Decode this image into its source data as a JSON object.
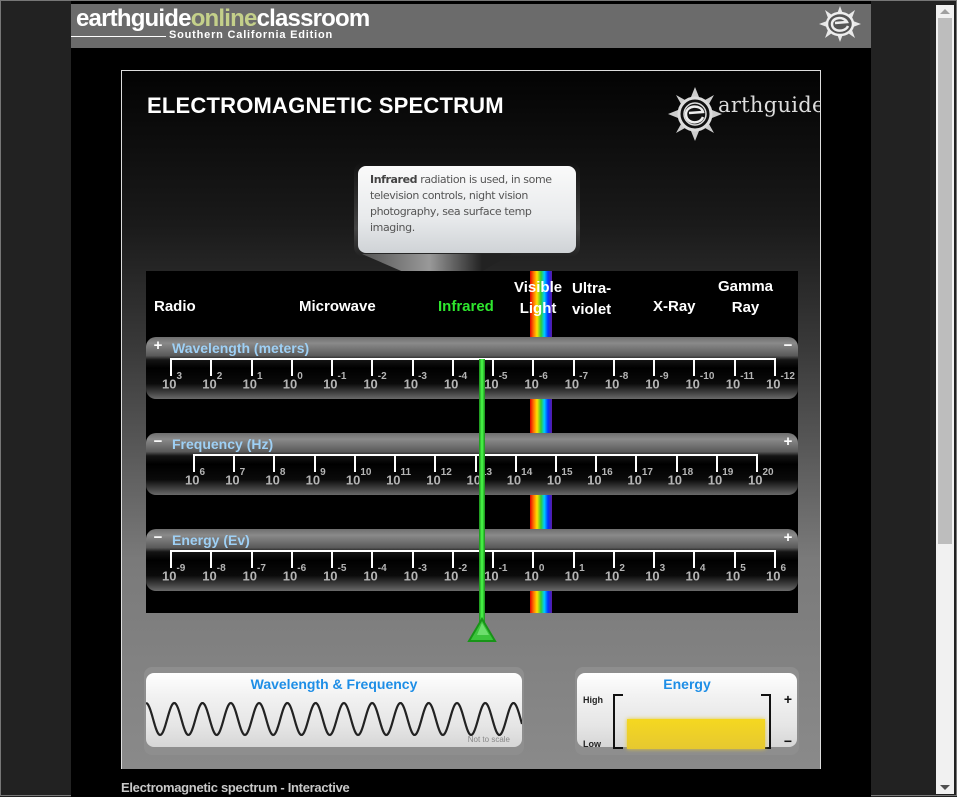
{
  "header": {
    "brand_part1": "earthguide",
    "brand_part2": "online",
    "brand_part3": "classroom",
    "subtitle": "Southern California Edition",
    "logo_icon": "earthguide-compass-icon"
  },
  "stage": {
    "title": "ELECTROMAGNETIC SPECTRUM",
    "logo_text": "arthguide",
    "logo_icon": "earthguide-compass-icon"
  },
  "tooltip": {
    "bold": "Infrared",
    "text": " radiation is used, in some television controls, night vision photography, sea surface temp imaging."
  },
  "bands": [
    {
      "label": "Radio",
      "active": false
    },
    {
      "label": "Microwave",
      "active": false
    },
    {
      "label": "Infrared",
      "active": true
    },
    {
      "label": "Visible Light",
      "line1": "Visible",
      "line2": "Light",
      "active": false
    },
    {
      "label": "Ultra-violet",
      "line1": "Ultra-",
      "line2": "violet",
      "active": false
    },
    {
      "label": "X-Ray",
      "active": false
    },
    {
      "label": "Gamma Ray",
      "line1": "Gamma",
      "line2": "Ray",
      "active": false
    }
  ],
  "scales": [
    {
      "title": "Wavelength (meters)",
      "left_button": "+",
      "right_button": "−",
      "exponents": [
        "3",
        "2",
        "1",
        "0",
        "-1",
        "-2",
        "-3",
        "-4",
        "-5",
        "-6",
        "-7",
        "-8",
        "-9",
        "-10",
        "-11",
        "-12"
      ]
    },
    {
      "title": "Frequency (Hz)",
      "left_button": "−",
      "right_button": "+",
      "exponents": [
        "6",
        "7",
        "8",
        "9",
        "10",
        "11",
        "12",
        "13",
        "14",
        "15",
        "16",
        "17",
        "18",
        "19",
        "20"
      ]
    },
    {
      "title": "Energy (Ev)",
      "left_button": "−",
      "right_button": "+",
      "exponents": [
        "-9",
        "-8",
        "-7",
        "-6",
        "-5",
        "-4",
        "-3",
        "-2",
        "-1",
        "0",
        "1",
        "2",
        "3",
        "4",
        "5",
        "6"
      ]
    }
  ],
  "tick_base": "10",
  "selected_band": "Infrared",
  "wave_panel": {
    "title": "Wavelength & Frequency",
    "note": "Not to scale"
  },
  "energy_panel": {
    "title": "Energy",
    "high_label": "High",
    "low_label": "Low",
    "plus": "+",
    "minus": "−",
    "level_fraction": 0.55
  },
  "caption": "Electromagnetic spectrum - Interactive",
  "colors": {
    "accent_blue": "#1e8ee6",
    "scale_title": "#9ed0f5",
    "active_band": "#2ee62e",
    "energy_fill": "#f0d428",
    "brand_online": "#c4d08a"
  }
}
